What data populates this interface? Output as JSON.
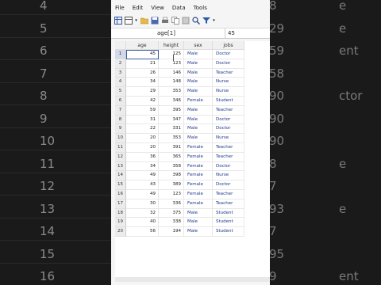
{
  "background": {
    "left_numbers": [
      "4",
      "5",
      "6",
      "7",
      "8",
      "9",
      "10",
      "11",
      "12",
      "13",
      "14",
      "15",
      "16"
    ],
    "right_numbers": [
      "8",
      "29",
      "59",
      "58",
      "90",
      "90",
      "90",
      "8",
      "7",
      "93",
      "7",
      "95",
      "9"
    ],
    "right_words": [
      "e",
      "e",
      "ent",
      "",
      "ctor",
      "",
      "",
      "e",
      "",
      "e",
      "",
      "",
      "ent"
    ]
  },
  "menu": {
    "items": [
      "File",
      "Edit",
      "View",
      "Data",
      "Tools"
    ]
  },
  "cellbar": {
    "name": "age[1]",
    "value": "45"
  },
  "table": {
    "columns": [
      "age",
      "height",
      "sex",
      "jobs"
    ],
    "rows": [
      {
        "id": "1",
        "age": "45",
        "height": "125",
        "sex": "Male",
        "jobs": "Doctor"
      },
      {
        "id": "2",
        "age": "21",
        "height": "123",
        "sex": "Male",
        "jobs": "Doctor"
      },
      {
        "id": "3",
        "age": "26",
        "height": "146",
        "sex": "Male",
        "jobs": "Teacher"
      },
      {
        "id": "4",
        "age": "34",
        "height": "148",
        "sex": "Male",
        "jobs": "Nurse"
      },
      {
        "id": "5",
        "age": "29",
        "height": "353",
        "sex": "Male",
        "jobs": "Nurse"
      },
      {
        "id": "6",
        "age": "42",
        "height": "346",
        "sex": "Female",
        "jobs": "Student"
      },
      {
        "id": "7",
        "age": "59",
        "height": "395",
        "sex": "Male",
        "jobs": "Teacher"
      },
      {
        "id": "8",
        "age": "31",
        "height": "347",
        "sex": "Male",
        "jobs": "Doctor"
      },
      {
        "id": "9",
        "age": "22",
        "height": "331",
        "sex": "Male",
        "jobs": "Doctor"
      },
      {
        "id": "10",
        "age": "20",
        "height": "353",
        "sex": "Male",
        "jobs": "Nurse"
      },
      {
        "id": "11",
        "age": "20",
        "height": "391",
        "sex": "Female",
        "jobs": "Teacher"
      },
      {
        "id": "12",
        "age": "36",
        "height": "365",
        "sex": "Female",
        "jobs": "Teacher"
      },
      {
        "id": "13",
        "age": "34",
        "height": "358",
        "sex": "Female",
        "jobs": "Doctor"
      },
      {
        "id": "14",
        "age": "49",
        "height": "398",
        "sex": "Female",
        "jobs": "Nurse"
      },
      {
        "id": "15",
        "age": "43",
        "height": "389",
        "sex": "Female",
        "jobs": "Doctor"
      },
      {
        "id": "16",
        "age": "49",
        "height": "123",
        "sex": "Female",
        "jobs": "Teacher"
      },
      {
        "id": "17",
        "age": "30",
        "height": "336",
        "sex": "Female",
        "jobs": "Teacher"
      },
      {
        "id": "18",
        "age": "32",
        "height": "375",
        "sex": "Male",
        "jobs": "Student"
      },
      {
        "id": "19",
        "age": "40",
        "height": "338",
        "sex": "Male",
        "jobs": "Student"
      },
      {
        "id": "20",
        "age": "56",
        "height": "194",
        "sex": "Male",
        "jobs": "Student"
      }
    ]
  }
}
